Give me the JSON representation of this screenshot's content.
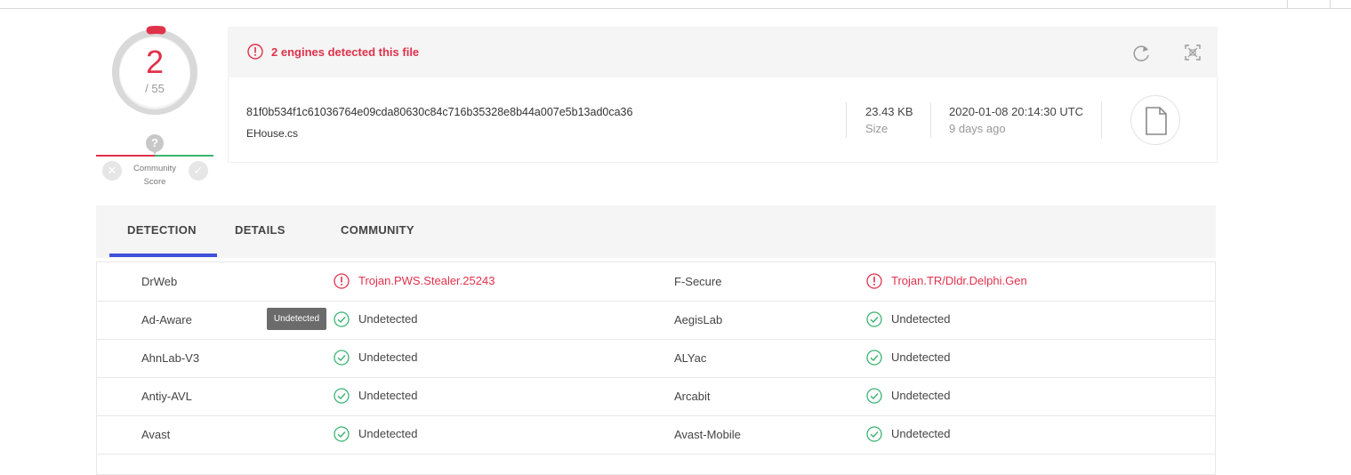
{
  "score": {
    "detected": "2",
    "total": "/ 55",
    "community_label_1": "Community",
    "community_label_2": "Score",
    "question_mark": "?",
    "neg_symbol": "✕",
    "pos_symbol": "✓"
  },
  "alert": {
    "text": "2 engines detected this file",
    "color": "#e0314b"
  },
  "file": {
    "hash": "81f0b534f1c61036764e09cda80630c84c716b35328e8b44a007e5b13ad0ca36",
    "name": "EHouse.cs",
    "size_value": "23.43 KB",
    "size_label": "Size",
    "date_value": "2020-01-08 20:14:30 UTC",
    "date_label": "9 days ago"
  },
  "tabs": [
    {
      "label": "DETECTION",
      "active": true
    },
    {
      "label": "DETAILS",
      "active": false
    },
    {
      "label": "COMMUNITY",
      "active": false
    }
  ],
  "detections": [
    {
      "left_engine": "DrWeb",
      "left_result": "Trojan.PWS.Stealer.25243",
      "left_status": "malicious",
      "right_engine": "F-Secure",
      "right_result": "Trojan.TR/Dldr.Delphi.Gen",
      "right_status": "malicious"
    },
    {
      "left_engine": "Ad-Aware",
      "left_result": "Undetected",
      "left_status": "clean",
      "right_engine": "AegisLab",
      "right_result": "Undetected",
      "right_status": "clean"
    },
    {
      "left_engine": "AhnLab-V3",
      "left_result": "Undetected",
      "left_status": "clean",
      "right_engine": "ALYac",
      "right_result": "Undetected",
      "right_status": "clean"
    },
    {
      "left_engine": "Antiy-AVL",
      "left_result": "Undetected",
      "left_status": "clean",
      "right_engine": "Arcabit",
      "right_result": "Undetected",
      "right_status": "clean"
    },
    {
      "left_engine": "Avast",
      "left_result": "Undetected",
      "left_status": "clean",
      "right_engine": "Avast-Mobile",
      "right_result": "Undetected",
      "right_status": "clean"
    }
  ],
  "tooltip": "Undetected",
  "colors": {
    "malicious": "#e0314b",
    "clean": "#3cb371",
    "accent": "#3f51d9"
  },
  "icons": {
    "alert": "alert-circle-icon",
    "reload": "reload-icon",
    "expand": "expand-icon",
    "file": "file-icon",
    "clean": "check-circle-icon",
    "malicious": "alert-circle-icon"
  }
}
